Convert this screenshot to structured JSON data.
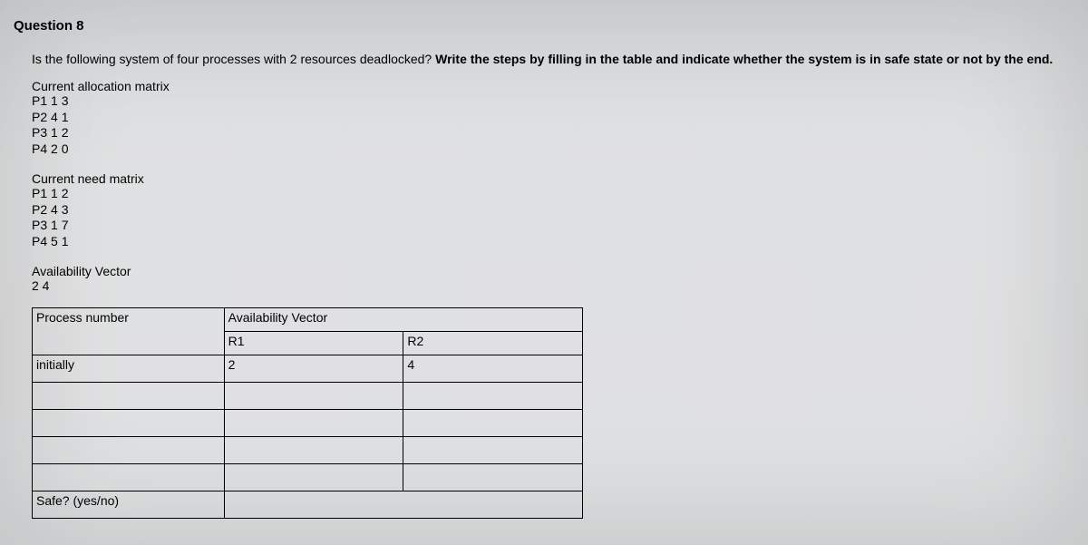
{
  "title": "Question 8",
  "prompt_plain": "Is the following system of four processes with 2 resources deadlocked? ",
  "prompt_bold": "Write the steps by filling in the table and indicate whether the system is in safe state or not by the end.",
  "allocation": {
    "header": "Current allocation matrix",
    "rows": [
      "P1 1 3",
      "P2 4 1",
      "P3 1 2",
      "P4 2 0"
    ]
  },
  "need": {
    "header": "Current need matrix",
    "rows": [
      "P1 1 2",
      "P2 4 3",
      "P3 1 7",
      "P4 5 1"
    ]
  },
  "availability": {
    "header": "Availability Vector",
    "value": "2 4"
  },
  "table": {
    "process_number": "Process number",
    "avail_vector": "Availability Vector",
    "r1": "R1",
    "r2": "R2",
    "initially": "initially",
    "init_r1": "2",
    "init_r2": "4",
    "safe": "Safe? (yes/no)"
  },
  "chart_data": {
    "type": "table",
    "allocation_matrix": {
      "resources": [
        "R1",
        "R2"
      ],
      "processes": {
        "P1": [
          1,
          3
        ],
        "P2": [
          4,
          1
        ],
        "P3": [
          1,
          2
        ],
        "P4": [
          2,
          0
        ]
      }
    },
    "need_matrix": {
      "resources": [
        "R1",
        "R2"
      ],
      "processes": {
        "P1": [
          1,
          2
        ],
        "P2": [
          4,
          3
        ],
        "P3": [
          1,
          7
        ],
        "P4": [
          5,
          1
        ]
      }
    },
    "availability_vector": {
      "R1": 2,
      "R2": 4
    },
    "answer_table": {
      "columns": [
        "Process number",
        "R1",
        "R2"
      ],
      "rows": [
        {
          "process": "initially",
          "R1": 2,
          "R2": 4
        },
        {
          "process": "",
          "R1": null,
          "R2": null
        },
        {
          "process": "",
          "R1": null,
          "R2": null
        },
        {
          "process": "",
          "R1": null,
          "R2": null
        },
        {
          "process": "",
          "R1": null,
          "R2": null
        }
      ],
      "safe_row": "Safe? (yes/no)"
    }
  }
}
